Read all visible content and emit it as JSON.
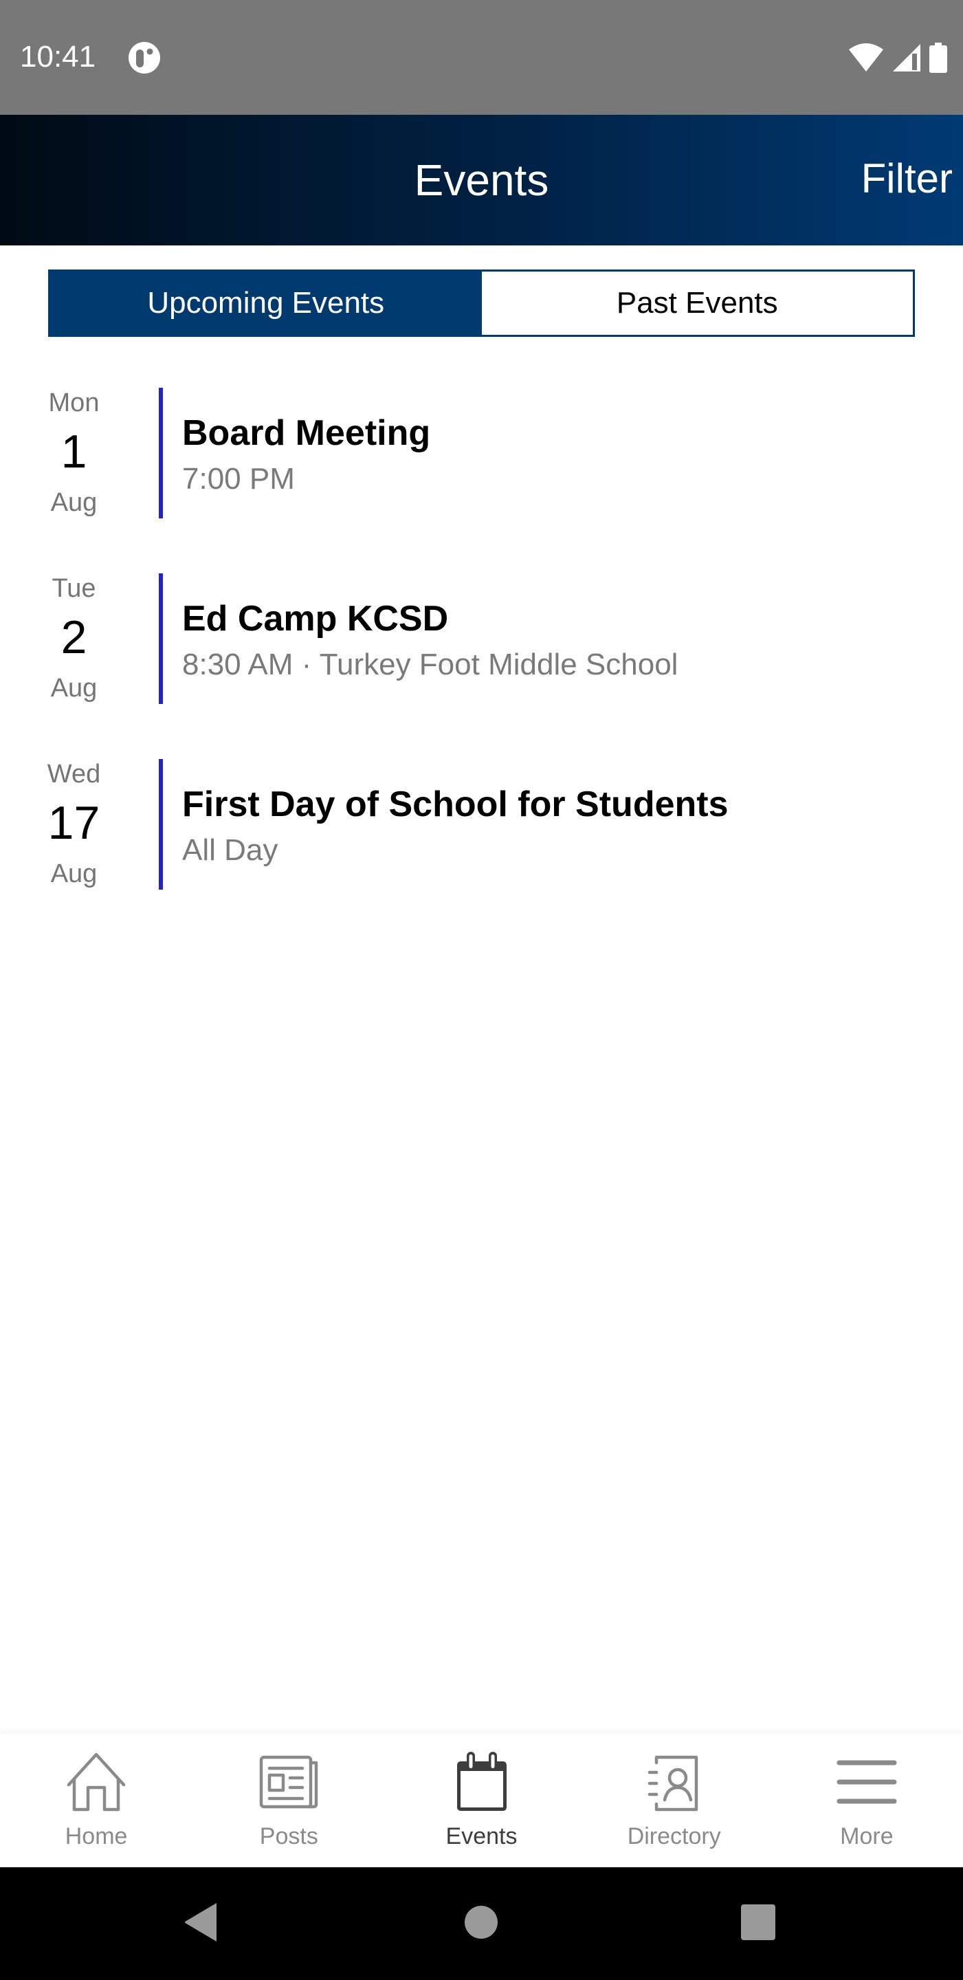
{
  "status_bar": {
    "time": "10:41",
    "icons": [
      "app-notification-icon",
      "wifi-icon",
      "cell-signal-icon",
      "battery-icon"
    ]
  },
  "header": {
    "title": "Events",
    "filter_label": "Filter"
  },
  "tabs": [
    {
      "label": "Upcoming Events",
      "active": true
    },
    {
      "label": "Past Events",
      "active": false
    }
  ],
  "accent_colors": {
    "header_dark": "#000a14",
    "header_light": "#003a74",
    "tab_active": "#003a6e",
    "event_bar": "#2323c8"
  },
  "events": [
    {
      "day_of_week": "Mon",
      "day": "1",
      "month": "Aug",
      "title": "Board Meeting",
      "subtitle": "7:00 PM"
    },
    {
      "day_of_week": "Tue",
      "day": "2",
      "month": "Aug",
      "title": "Ed Camp KCSD",
      "subtitle": "8:30 AM · Turkey Foot Middle School"
    },
    {
      "day_of_week": "Wed",
      "day": "17",
      "month": "Aug",
      "title": "First Day of School for Students",
      "subtitle": "All Day"
    }
  ],
  "bottom_nav": [
    {
      "label": "Home",
      "icon": "home-icon",
      "active": false
    },
    {
      "label": "Posts",
      "icon": "newspaper-icon",
      "active": false
    },
    {
      "label": "Events",
      "icon": "calendar-icon",
      "active": true
    },
    {
      "label": "Directory",
      "icon": "contact-book-icon",
      "active": false
    },
    {
      "label": "More",
      "icon": "menu-icon",
      "active": false
    }
  ],
  "system_nav": [
    "back-icon",
    "home-circle-icon",
    "recents-icon"
  ]
}
